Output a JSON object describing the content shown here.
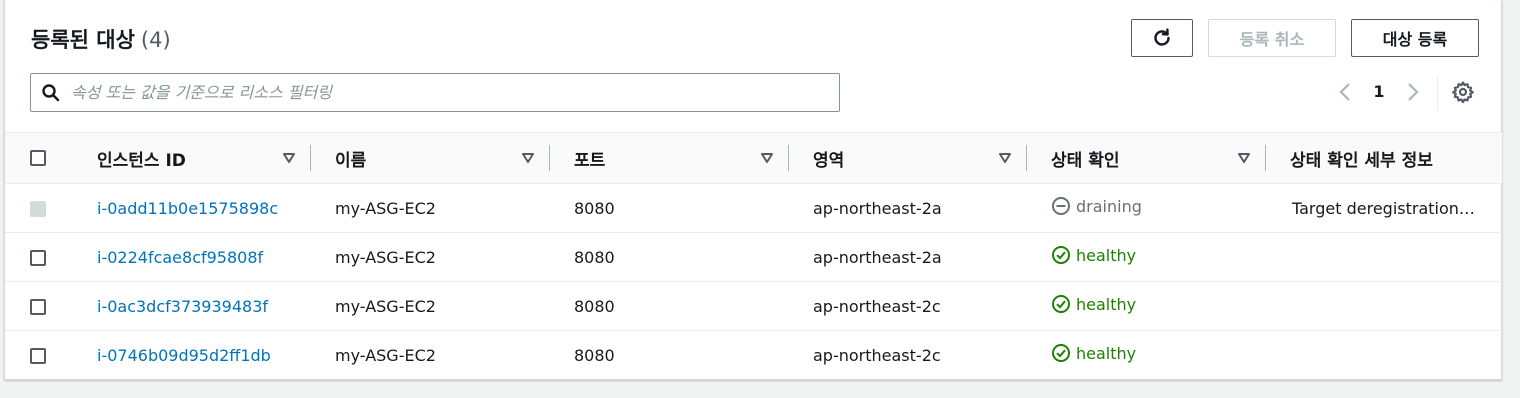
{
  "header": {
    "title": "등록된 대상",
    "count": "(4)"
  },
  "toolbar": {
    "refresh_icon": "refresh-icon",
    "deregister_label": "등록 취소",
    "register_label": "대상 등록"
  },
  "search": {
    "placeholder": "속성 또는 값을 기준으로 리소스 필터링",
    "value": ""
  },
  "pagination": {
    "current_page": "1"
  },
  "table": {
    "columns": [
      "인스턴스 ID",
      "이름",
      "포트",
      "영역",
      "상태 확인",
      "상태 확인 세부 정보"
    ],
    "rows": [
      {
        "instance_id": "i-0add11b0e1575898c",
        "name": "my-ASG-EC2",
        "port": "8080",
        "zone": "ap-northeast-2a",
        "status": "draining",
        "details": "Target deregistration…",
        "checkbox_disabled": true
      },
      {
        "instance_id": "i-0224fcae8cf95808f",
        "name": "my-ASG-EC2",
        "port": "8080",
        "zone": "ap-northeast-2a",
        "status": "healthy",
        "details": "",
        "checkbox_disabled": false
      },
      {
        "instance_id": "i-0ac3dcf373939483f",
        "name": "my-ASG-EC2",
        "port": "8080",
        "zone": "ap-northeast-2c",
        "status": "healthy",
        "details": "",
        "checkbox_disabled": false
      },
      {
        "instance_id": "i-0746b09d95d2ff1db",
        "name": "my-ASG-EC2",
        "port": "8080",
        "zone": "ap-northeast-2c",
        "status": "healthy",
        "details": "",
        "checkbox_disabled": false
      }
    ]
  },
  "colors": {
    "link": "#0073bb",
    "healthy": "#1d8102",
    "draining": "#687078",
    "border": "#eaeded"
  }
}
